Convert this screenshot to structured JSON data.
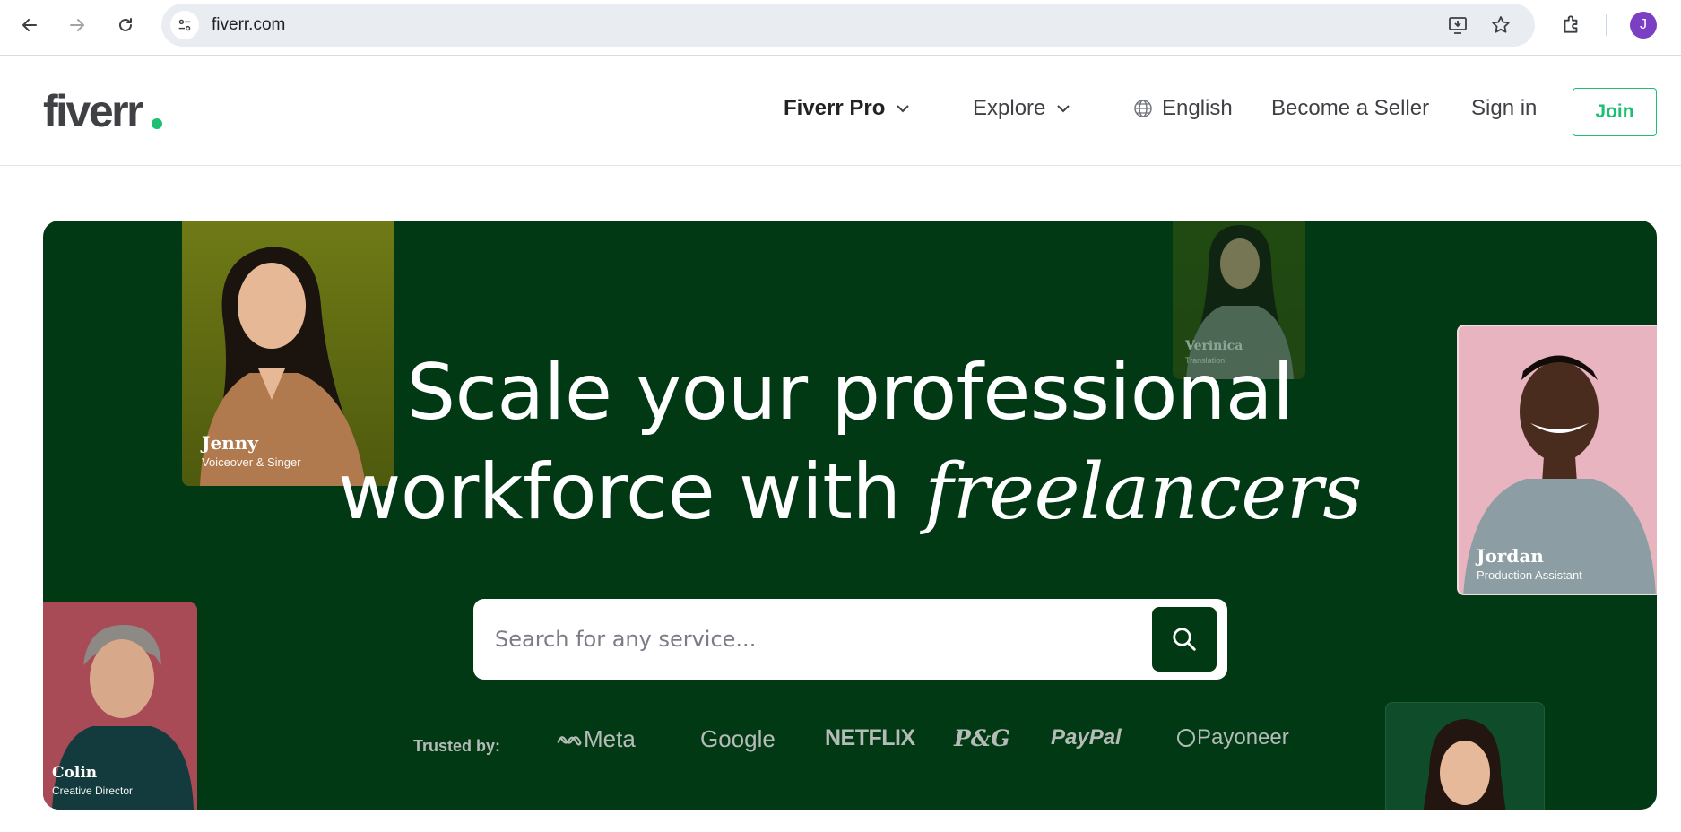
{
  "browser": {
    "url": "fiverr.com",
    "avatar_initial": "J"
  },
  "header": {
    "logo": "fiverr",
    "nav": {
      "pro": "Fiverr Pro",
      "explore": "Explore",
      "language": "English",
      "become_seller": "Become a Seller",
      "sign_in": "Sign in",
      "join": "Join"
    }
  },
  "hero": {
    "title_line1": "Scale your professional",
    "title_line2_prefix": "workforce with",
    "title_line2_italic": "freelancers",
    "search_placeholder": "Search for any service...",
    "trusted_label": "Trusted by:",
    "brands": [
      "Meta",
      "Google",
      "NETFLIX",
      "P&G",
      "PayPal",
      "Payoneer"
    ],
    "freelancers": [
      {
        "name": "Jenny",
        "role": "Voiceover & Singer"
      },
      {
        "name": "Verinica",
        "role": "Translation"
      },
      {
        "name": "Jordan",
        "role": "Production Assistant"
      },
      {
        "name": "Colin",
        "role": "Creative Director"
      }
    ]
  },
  "colors": {
    "brand_green": "#1dbf73",
    "hero_bg": "#013914"
  }
}
